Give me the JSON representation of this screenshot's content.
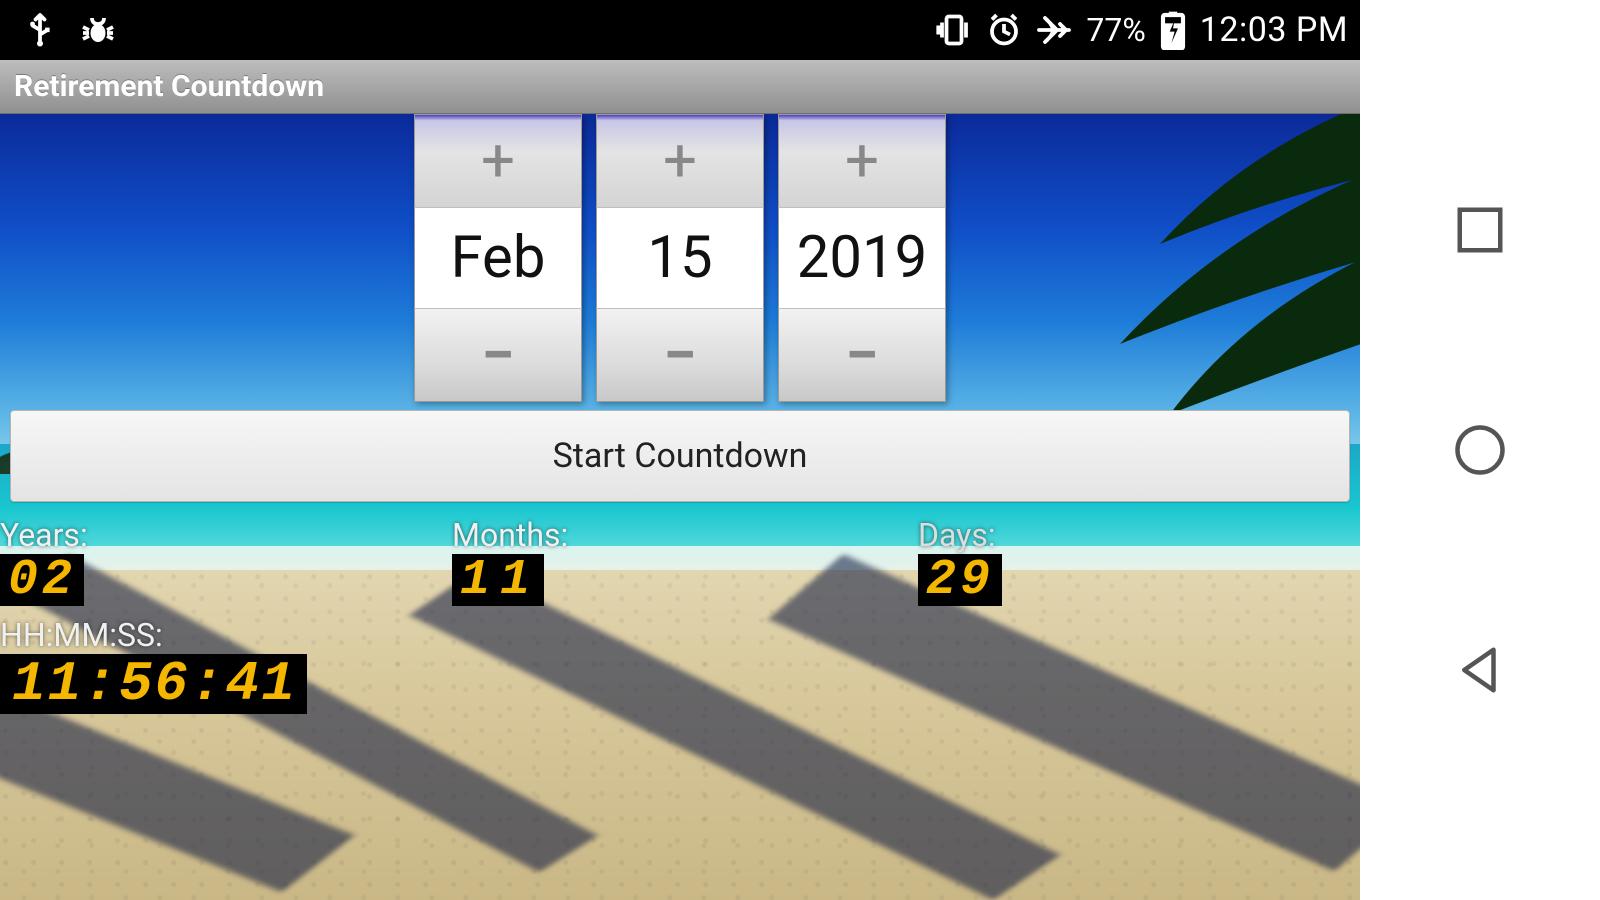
{
  "status": {
    "battery_percent": "77%",
    "time": "12:03 PM"
  },
  "app": {
    "title": "Retirement Countdown"
  },
  "picker": {
    "month": "Feb",
    "day": "15",
    "year": "2019"
  },
  "buttons": {
    "start": "Start Countdown"
  },
  "countdown": {
    "labels": {
      "years": "Years:",
      "months": "Months:",
      "days": "Days:",
      "hms": "HH:MM:SS:"
    },
    "values": {
      "years": "02",
      "months": "11",
      "days": "29",
      "hms": "11:56:41"
    }
  }
}
